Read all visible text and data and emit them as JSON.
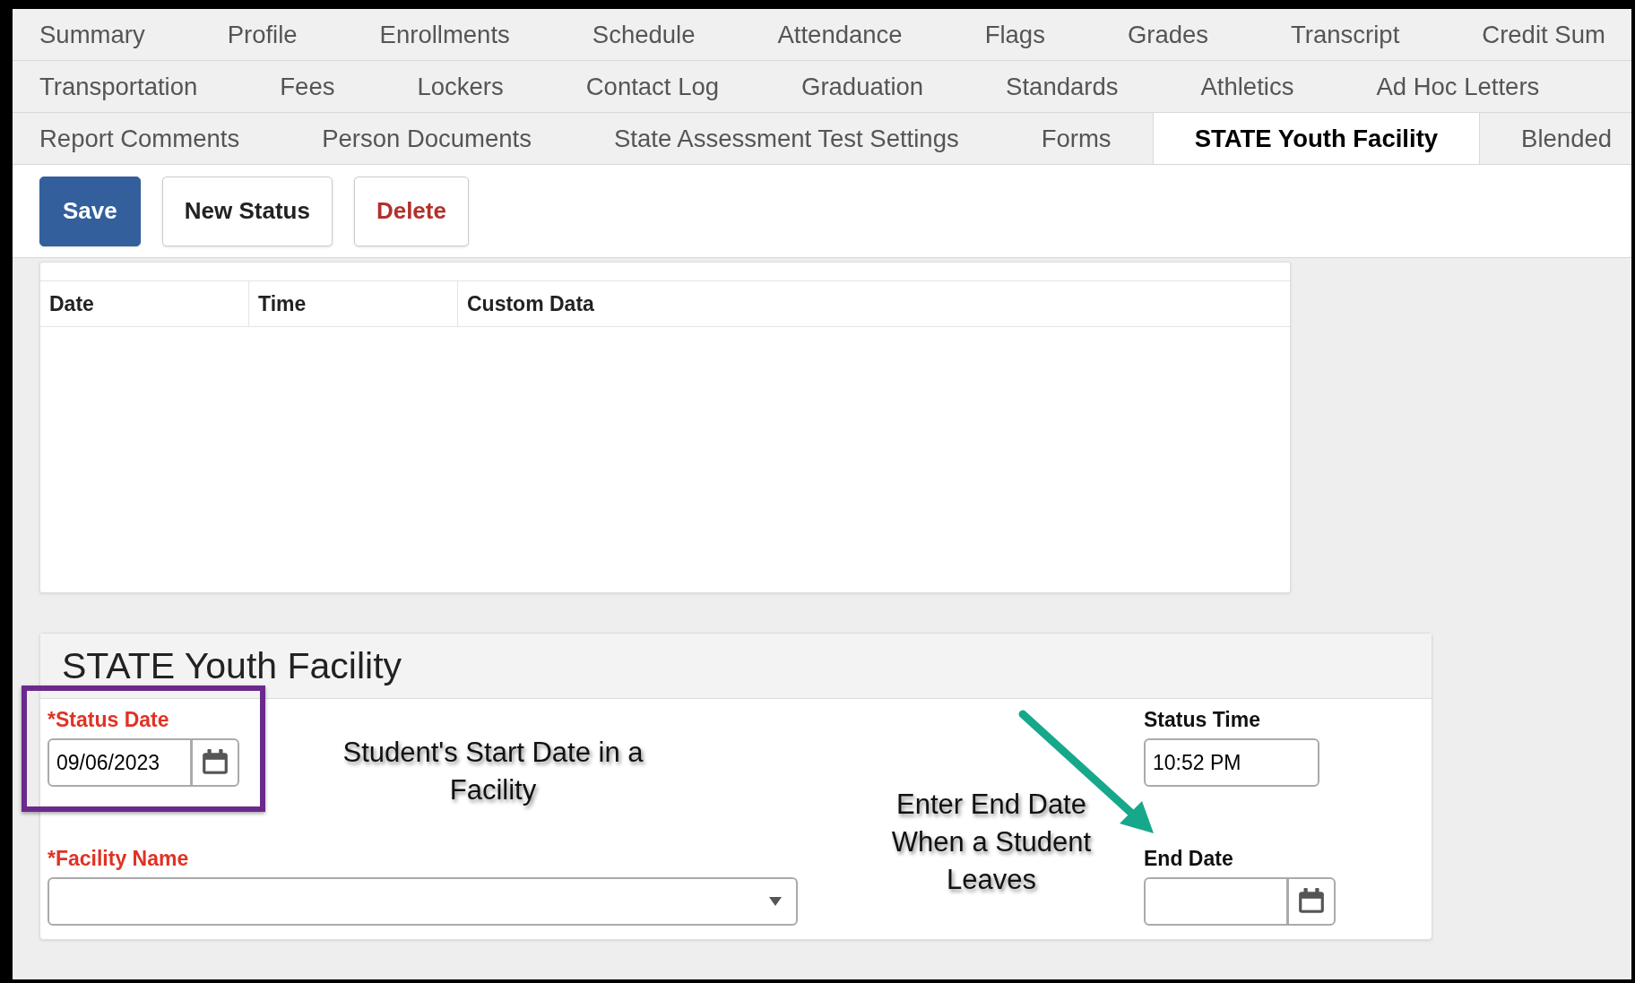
{
  "tab_rows": [
    [
      {
        "label": "Summary",
        "selected": false
      },
      {
        "label": "Profile",
        "selected": false
      },
      {
        "label": "Enrollments",
        "selected": false
      },
      {
        "label": "Schedule",
        "selected": false
      },
      {
        "label": "Attendance",
        "selected": false
      },
      {
        "label": "Flags",
        "selected": false
      },
      {
        "label": "Grades",
        "selected": false
      },
      {
        "label": "Transcript",
        "selected": false
      },
      {
        "label": "Credit Sum",
        "selected": false
      }
    ],
    [
      {
        "label": "Transportation",
        "selected": false
      },
      {
        "label": "Fees",
        "selected": false
      },
      {
        "label": "Lockers",
        "selected": false
      },
      {
        "label": "Contact Log",
        "selected": false
      },
      {
        "label": "Graduation",
        "selected": false
      },
      {
        "label": "Standards",
        "selected": false
      },
      {
        "label": "Athletics",
        "selected": false
      },
      {
        "label": "Ad Hoc Letters",
        "selected": false
      }
    ],
    [
      {
        "label": "Report Comments",
        "selected": false
      },
      {
        "label": "Person Documents",
        "selected": false
      },
      {
        "label": "State Assessment Test Settings",
        "selected": false
      },
      {
        "label": "Forms",
        "selected": false
      },
      {
        "label": "STATE Youth Facility",
        "selected": true
      },
      {
        "label": "Blended",
        "selected": false
      }
    ]
  ],
  "toolbar": {
    "buttons": [
      {
        "label": "Save",
        "kind": "primary"
      },
      {
        "label": "New Status",
        "kind": "default"
      },
      {
        "label": "Delete",
        "kind": "danger"
      }
    ]
  },
  "history_table": {
    "columns": [
      "Date",
      "Time",
      "Custom Data"
    ]
  },
  "form": {
    "title": "STATE Youth Facility",
    "fields": [
      {
        "label": "*Status Date",
        "required": true,
        "kind": "date",
        "value": "09/06/2023"
      },
      {
        "label": "Status Time",
        "required": false,
        "kind": "text",
        "value": "10:52 PM"
      },
      {
        "label": "*Facility Name",
        "required": true,
        "kind": "select"
      },
      {
        "label": "End Date",
        "required": false,
        "kind": "date"
      }
    ]
  },
  "annotations": [
    {
      "kind": "start-note",
      "text": "Student's Start Date in a Facility"
    },
    {
      "kind": "end-note",
      "text": "Enter End Date When a Student Leaves"
    }
  ]
}
